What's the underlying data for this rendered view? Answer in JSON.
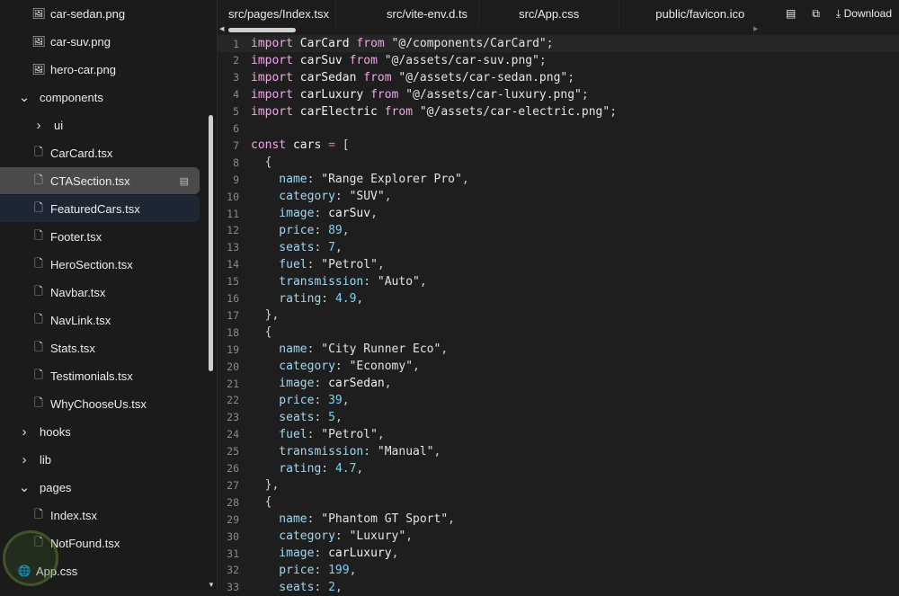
{
  "sidebar": {
    "items": [
      {
        "label": "car-sedan.png",
        "icon": "image-icon",
        "kind": "file",
        "indent": 2
      },
      {
        "label": "car-suv.png",
        "icon": "image-icon",
        "kind": "file",
        "indent": 2
      },
      {
        "label": "hero-car.png",
        "icon": "image-icon",
        "kind": "file",
        "indent": 2
      },
      {
        "label": "components",
        "icon": "chevron-down-icon",
        "kind": "folder",
        "indent": 1
      },
      {
        "label": "ui",
        "icon": "chevron-right-icon",
        "kind": "folder",
        "indent": 2
      },
      {
        "label": "CarCard.tsx",
        "icon": "file-code-icon",
        "kind": "file",
        "indent": 2
      },
      {
        "label": "CTASection.tsx",
        "icon": "file-code-icon",
        "kind": "file",
        "indent": 2,
        "state": "selected"
      },
      {
        "label": "FeaturedCars.tsx",
        "icon": "file-code-icon",
        "kind": "file",
        "indent": 2,
        "state": "hover"
      },
      {
        "label": "Footer.tsx",
        "icon": "file-code-icon",
        "kind": "file",
        "indent": 2
      },
      {
        "label": "HeroSection.tsx",
        "icon": "file-code-icon",
        "kind": "file",
        "indent": 2
      },
      {
        "label": "Navbar.tsx",
        "icon": "file-code-icon",
        "kind": "file",
        "indent": 2
      },
      {
        "label": "NavLink.tsx",
        "icon": "file-code-icon",
        "kind": "file",
        "indent": 2
      },
      {
        "label": "Stats.tsx",
        "icon": "file-code-icon",
        "kind": "file",
        "indent": 2
      },
      {
        "label": "Testimonials.tsx",
        "icon": "file-code-icon",
        "kind": "file",
        "indent": 2
      },
      {
        "label": "WhyChooseUs.tsx",
        "icon": "file-code-icon",
        "kind": "file",
        "indent": 2
      },
      {
        "label": "hooks",
        "icon": "chevron-right-icon",
        "kind": "folder",
        "indent": 1
      },
      {
        "label": "lib",
        "icon": "chevron-right-icon",
        "kind": "folder",
        "indent": 1
      },
      {
        "label": "pages",
        "icon": "chevron-down-icon",
        "kind": "folder",
        "indent": 1
      },
      {
        "label": "Index.tsx",
        "icon": "file-code-icon",
        "kind": "file",
        "indent": 2
      },
      {
        "label": "NotFound.tsx",
        "icon": "file-code-icon",
        "kind": "file",
        "indent": 2
      },
      {
        "label": "App.css",
        "icon": "globe-icon",
        "kind": "file",
        "indent": 1
      }
    ]
  },
  "tabs": [
    "src/pages/Index.tsx",
    "src/vite-env.d.ts",
    "src/App.css",
    "public/favicon.ico"
  ],
  "toolbar": {
    "download_label": "Download"
  },
  "editor": {
    "current_line": 1,
    "lines": [
      [
        [
          "kw",
          "import"
        ],
        [
          "id",
          " CarCard "
        ],
        [
          "kw",
          "from"
        ],
        [
          "str",
          " \"@/components/CarCard\""
        ],
        [
          "punc",
          ";"
        ]
      ],
      [
        [
          "kw",
          "import"
        ],
        [
          "id",
          " carSuv "
        ],
        [
          "kw",
          "from"
        ],
        [
          "str",
          " \"@/assets/car-suv.png\""
        ],
        [
          "punc",
          ";"
        ]
      ],
      [
        [
          "kw",
          "import"
        ],
        [
          "id",
          " carSedan "
        ],
        [
          "kw",
          "from"
        ],
        [
          "str",
          " \"@/assets/car-sedan.png\""
        ],
        [
          "punc",
          ";"
        ]
      ],
      [
        [
          "kw",
          "import"
        ],
        [
          "id",
          " carLuxury "
        ],
        [
          "kw",
          "from"
        ],
        [
          "str",
          " \"@/assets/car-luxury.png\""
        ],
        [
          "punc",
          ";"
        ]
      ],
      [
        [
          "kw",
          "import"
        ],
        [
          "id",
          " carElectric "
        ],
        [
          "kw",
          "from"
        ],
        [
          "str",
          " \"@/assets/car-electric.png\""
        ],
        [
          "punc",
          ";"
        ]
      ],
      [],
      [
        [
          "kw",
          "const"
        ],
        [
          "id",
          " cars "
        ],
        [
          "op",
          "="
        ],
        [
          "punc",
          " ["
        ]
      ],
      [
        [
          "punc",
          "  {"
        ]
      ],
      [
        [
          "key",
          "    name"
        ],
        [
          "punc",
          ": "
        ],
        [
          "str",
          "\"Range Explorer Pro\""
        ],
        [
          "punc",
          ","
        ]
      ],
      [
        [
          "key",
          "    category"
        ],
        [
          "punc",
          ": "
        ],
        [
          "str",
          "\"SUV\""
        ],
        [
          "punc",
          ","
        ]
      ],
      [
        [
          "key",
          "    image"
        ],
        [
          "punc",
          ": "
        ],
        [
          "id",
          "carSuv"
        ],
        [
          "punc",
          ","
        ]
      ],
      [
        [
          "key",
          "    price"
        ],
        [
          "punc",
          ": "
        ],
        [
          "num",
          "89"
        ],
        [
          "punc",
          ","
        ]
      ],
      [
        [
          "key",
          "    seats"
        ],
        [
          "punc",
          ": "
        ],
        [
          "num",
          "7"
        ],
        [
          "punc",
          ","
        ]
      ],
      [
        [
          "key",
          "    fuel"
        ],
        [
          "punc",
          ": "
        ],
        [
          "str",
          "\"Petrol\""
        ],
        [
          "punc",
          ","
        ]
      ],
      [
        [
          "key",
          "    transmission"
        ],
        [
          "punc",
          ": "
        ],
        [
          "str",
          "\"Auto\""
        ],
        [
          "punc",
          ","
        ]
      ],
      [
        [
          "key",
          "    rating"
        ],
        [
          "punc",
          ": "
        ],
        [
          "num",
          "4.9"
        ],
        [
          "punc",
          ","
        ]
      ],
      [
        [
          "punc",
          "  },"
        ]
      ],
      [
        [
          "punc",
          "  {"
        ]
      ],
      [
        [
          "key",
          "    name"
        ],
        [
          "punc",
          ": "
        ],
        [
          "str",
          "\"City Runner Eco\""
        ],
        [
          "punc",
          ","
        ]
      ],
      [
        [
          "key",
          "    category"
        ],
        [
          "punc",
          ": "
        ],
        [
          "str",
          "\"Economy\""
        ],
        [
          "punc",
          ","
        ]
      ],
      [
        [
          "key",
          "    image"
        ],
        [
          "punc",
          ": "
        ],
        [
          "id",
          "carSedan"
        ],
        [
          "punc",
          ","
        ]
      ],
      [
        [
          "key",
          "    price"
        ],
        [
          "punc",
          ": "
        ],
        [
          "num",
          "39"
        ],
        [
          "punc",
          ","
        ]
      ],
      [
        [
          "key",
          "    seats"
        ],
        [
          "punc",
          ": "
        ],
        [
          "num",
          "5"
        ],
        [
          "punc",
          ","
        ]
      ],
      [
        [
          "key",
          "    fuel"
        ],
        [
          "punc",
          ": "
        ],
        [
          "str",
          "\"Petrol\""
        ],
        [
          "punc",
          ","
        ]
      ],
      [
        [
          "key",
          "    transmission"
        ],
        [
          "punc",
          ": "
        ],
        [
          "str",
          "\"Manual\""
        ],
        [
          "punc",
          ","
        ]
      ],
      [
        [
          "key",
          "    rating"
        ],
        [
          "punc",
          ": "
        ],
        [
          "num",
          "4.7"
        ],
        [
          "punc",
          ","
        ]
      ],
      [
        [
          "punc",
          "  },"
        ]
      ],
      [
        [
          "punc",
          "  {"
        ]
      ],
      [
        [
          "key",
          "    name"
        ],
        [
          "punc",
          ": "
        ],
        [
          "str",
          "\"Phantom GT Sport\""
        ],
        [
          "punc",
          ","
        ]
      ],
      [
        [
          "key",
          "    category"
        ],
        [
          "punc",
          ": "
        ],
        [
          "str",
          "\"Luxury\""
        ],
        [
          "punc",
          ","
        ]
      ],
      [
        [
          "key",
          "    image"
        ],
        [
          "punc",
          ": "
        ],
        [
          "id",
          "carLuxury"
        ],
        [
          "punc",
          ","
        ]
      ],
      [
        [
          "key",
          "    price"
        ],
        [
          "punc",
          ": "
        ],
        [
          "num",
          "199"
        ],
        [
          "punc",
          ","
        ]
      ],
      [
        [
          "key",
          "    seats"
        ],
        [
          "punc",
          ": "
        ],
        [
          "num",
          "2"
        ],
        [
          "punc",
          ","
        ]
      ]
    ]
  }
}
